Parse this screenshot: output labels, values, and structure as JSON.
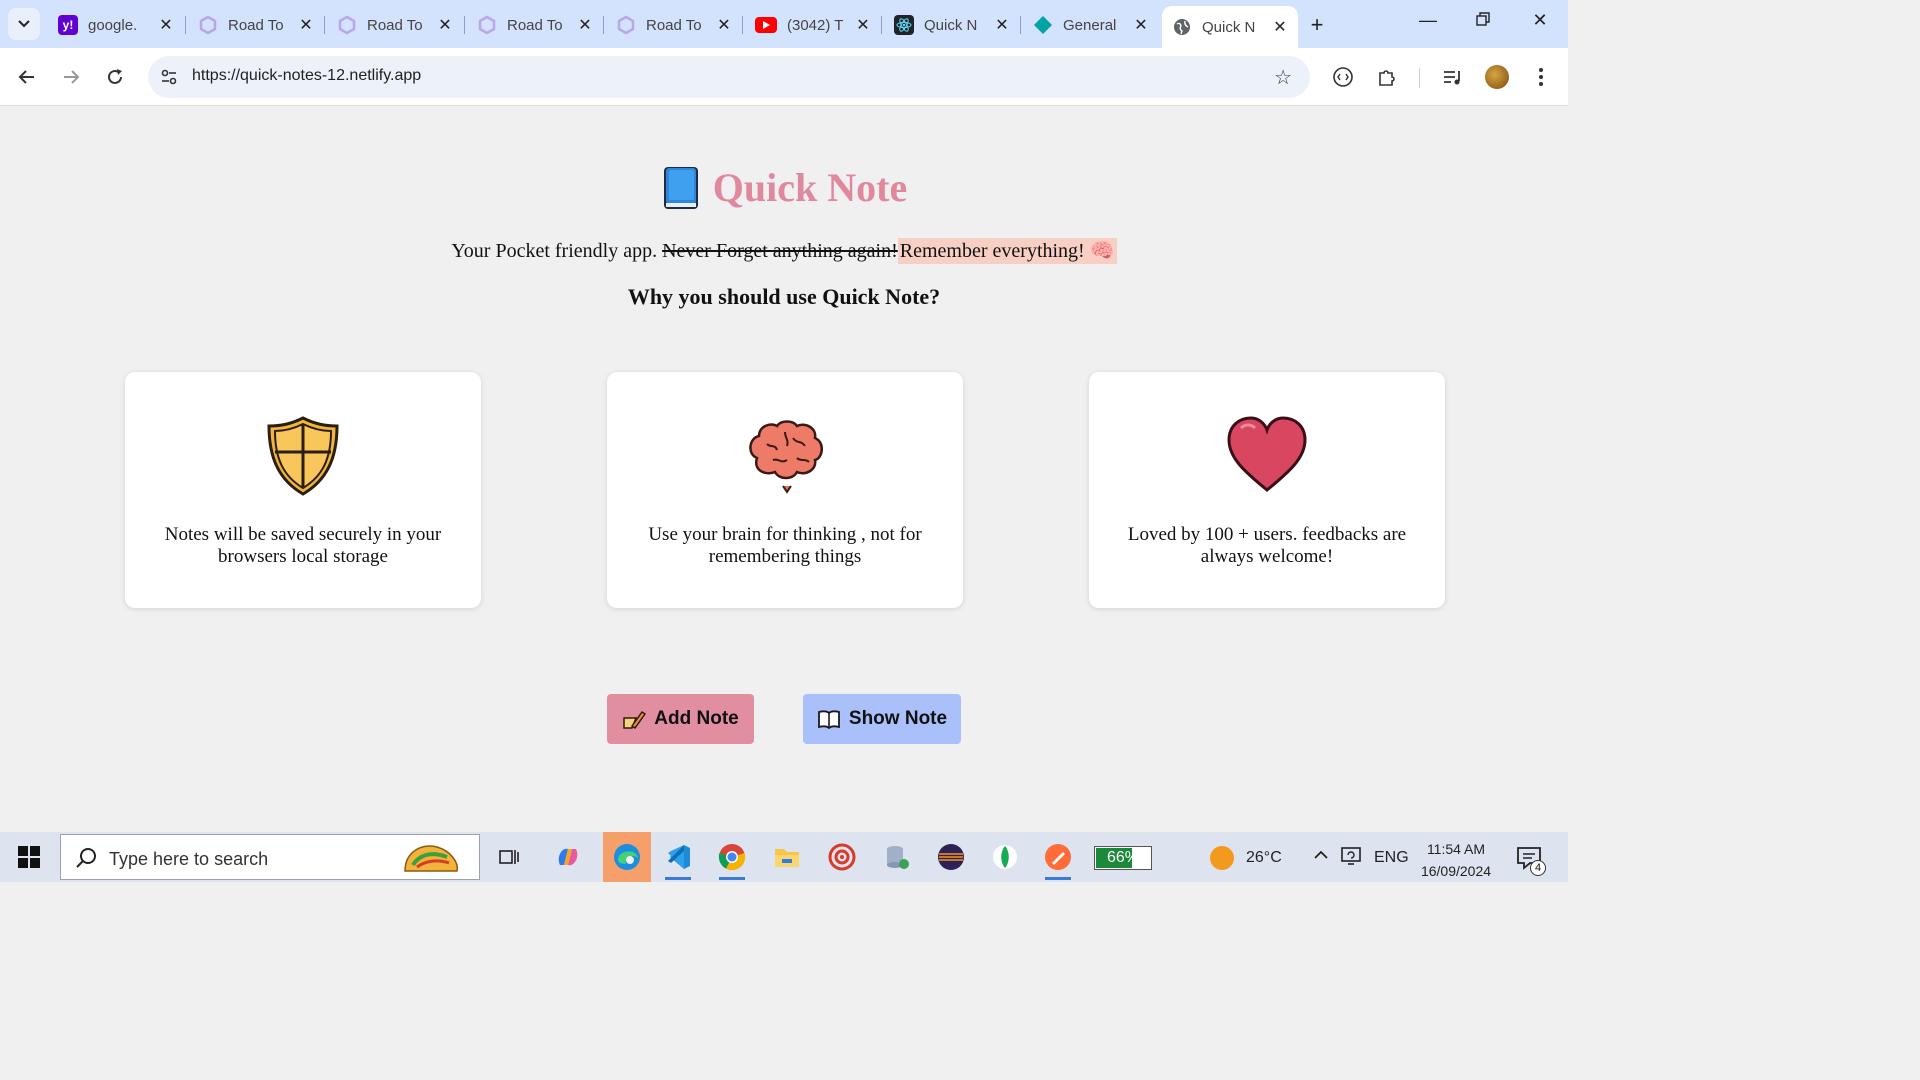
{
  "browser": {
    "tabs": [
      {
        "title": "google.",
        "favicon": "yahoo-icon",
        "color": "#6001d2"
      },
      {
        "title": "Road To",
        "favicon": "roadmap-icon",
        "color": "#c9a0ff"
      },
      {
        "title": "Road To",
        "favicon": "roadmap-icon",
        "color": "#c9a0ff"
      },
      {
        "title": "Road To",
        "favicon": "roadmap-icon",
        "color": "#c9a0ff"
      },
      {
        "title": "Road To",
        "favicon": "roadmap-icon",
        "color": "#c9a0ff"
      },
      {
        "title": "(3042) T",
        "favicon": "youtube-icon",
        "color": "#ff0000"
      },
      {
        "title": "Quick N",
        "favicon": "react-icon",
        "color": "#20232a"
      },
      {
        "title": "General",
        "favicon": "diamond-icon",
        "color": "#00a3a3"
      },
      {
        "title": "Quick N",
        "favicon": "globe-icon",
        "color": "#555555",
        "active": true
      }
    ],
    "url": "https://quick-notes-12.netlify.app"
  },
  "app": {
    "title": "Quick Note",
    "tagline_prefix": "Your Pocket friendly app. ",
    "tagline_strike": "Never Forget anything again!",
    "tagline_highlight": "Remember everything! 🧠",
    "why_heading": "Why you should use Quick Note?",
    "features": [
      {
        "icon": "shield-icon",
        "text": "Notes will be saved securely in your browsers local storage"
      },
      {
        "icon": "brain-icon",
        "text": "Use your brain for thinking , not for remembering things"
      },
      {
        "icon": "heart-icon",
        "text": "Loved by 100 + users. feedbacks are always welcome!"
      }
    ],
    "buttons": {
      "add_label": "Add Note",
      "show_label": "Show Note"
    },
    "colors": {
      "accent_pink": "#e0899e",
      "add_bg": "#e18ea0",
      "show_bg": "#a9c0fb",
      "highlight": "#f7cfc4"
    }
  },
  "taskbar": {
    "search_placeholder": "Type here to search",
    "battery": "66%",
    "battery_level": 0.66,
    "temperature": "26°C",
    "language": "ENG",
    "time": "11:54 AM",
    "date": "16/09/2024",
    "notification_count": "4"
  }
}
